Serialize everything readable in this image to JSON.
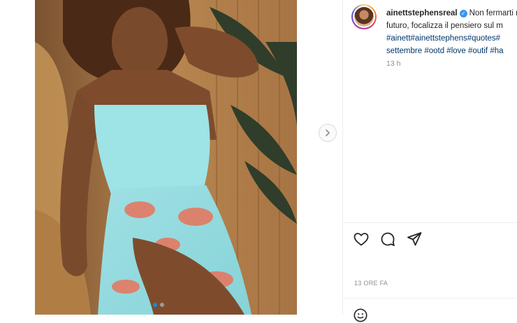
{
  "post": {
    "username": "ainettstephensreal",
    "caption_lines": [
      "Non fermarti mai a pensare al",
      "futuro, focalizza il pensiero sul m",
      "#ainett#ainettstephens#quotes#",
      "settembre #ootd #love #outif #ha"
    ],
    "caption_first": "Non fermarti mai a pensare al",
    "caption_line2": "futuro, focalizza il pensiero sul m",
    "caption_line3": "#ainett#ainettstephens#quotes#",
    "caption_line4": "settembre #ootd #love #outif #ha",
    "time_short": "13 h",
    "time_long": "13 ORE FA",
    "verified_mark": "✓"
  },
  "carousel": {
    "slide_count": 2,
    "active_index": 0
  },
  "icons": {
    "next": "chevron-right-icon",
    "like": "heart-icon",
    "comment": "comment-icon",
    "share": "paper-plane-icon",
    "emoji": "emoji-icon"
  },
  "colors": {
    "link": "#00376b",
    "verified": "#3897f0",
    "meta": "#8e8e8e",
    "active_dot": "#0095f6"
  }
}
